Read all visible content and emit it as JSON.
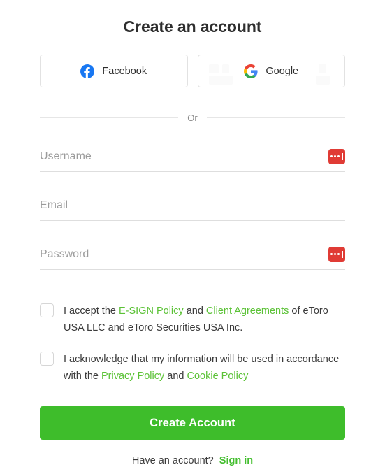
{
  "page": {
    "title": "Create an account",
    "background_color": "#ffffff"
  },
  "social": {
    "buttons": [
      {
        "label": "Facebook",
        "icon": "facebook-icon",
        "icon_color": "#1877F2"
      },
      {
        "label": "Google",
        "icon": "google-icon",
        "icon_color": "#4285F4"
      }
    ]
  },
  "divider": {
    "label": "Or"
  },
  "fields": [
    {
      "name": "username",
      "placeholder": "Username",
      "value": "",
      "icon": "password-manager-icon",
      "icon_color": "#e03b35"
    },
    {
      "name": "email",
      "placeholder": "Email",
      "value": "",
      "icon": null
    },
    {
      "name": "password",
      "placeholder": "Password",
      "value": "",
      "icon": "password-manager-icon",
      "icon_color": "#e03b35"
    }
  ],
  "consents": [
    {
      "checked": false,
      "parts": [
        {
          "text": "I accept the ",
          "link": false
        },
        {
          "text": "E-SIGN Policy",
          "link": true
        },
        {
          "text": " and ",
          "link": false
        },
        {
          "text": "Client Agreements",
          "link": true
        },
        {
          "text": " of eToro USA LLC and eToro Securities USA Inc.",
          "link": false
        }
      ]
    },
    {
      "checked": false,
      "parts": [
        {
          "text": "I acknowledge that my information will be used in accordance with the ",
          "link": false
        },
        {
          "text": "Privacy Policy",
          "link": true
        },
        {
          "text": " and ",
          "link": false
        },
        {
          "text": "Cookie Policy",
          "link": true
        }
      ]
    }
  ],
  "submit": {
    "label": "Create Account",
    "color": "#3ebd2b"
  },
  "footer": {
    "prompt": "Have an account?",
    "link_label": "Sign in",
    "link_color": "#43be2e"
  },
  "colors": {
    "link_green": "#5bc236",
    "button_green": "#3ebd2b",
    "autofill_red": "#e03b35",
    "text_dark": "#2e2e2e",
    "placeholder_gray": "#9b9b9b",
    "border_gray": "#e2e2e2"
  }
}
